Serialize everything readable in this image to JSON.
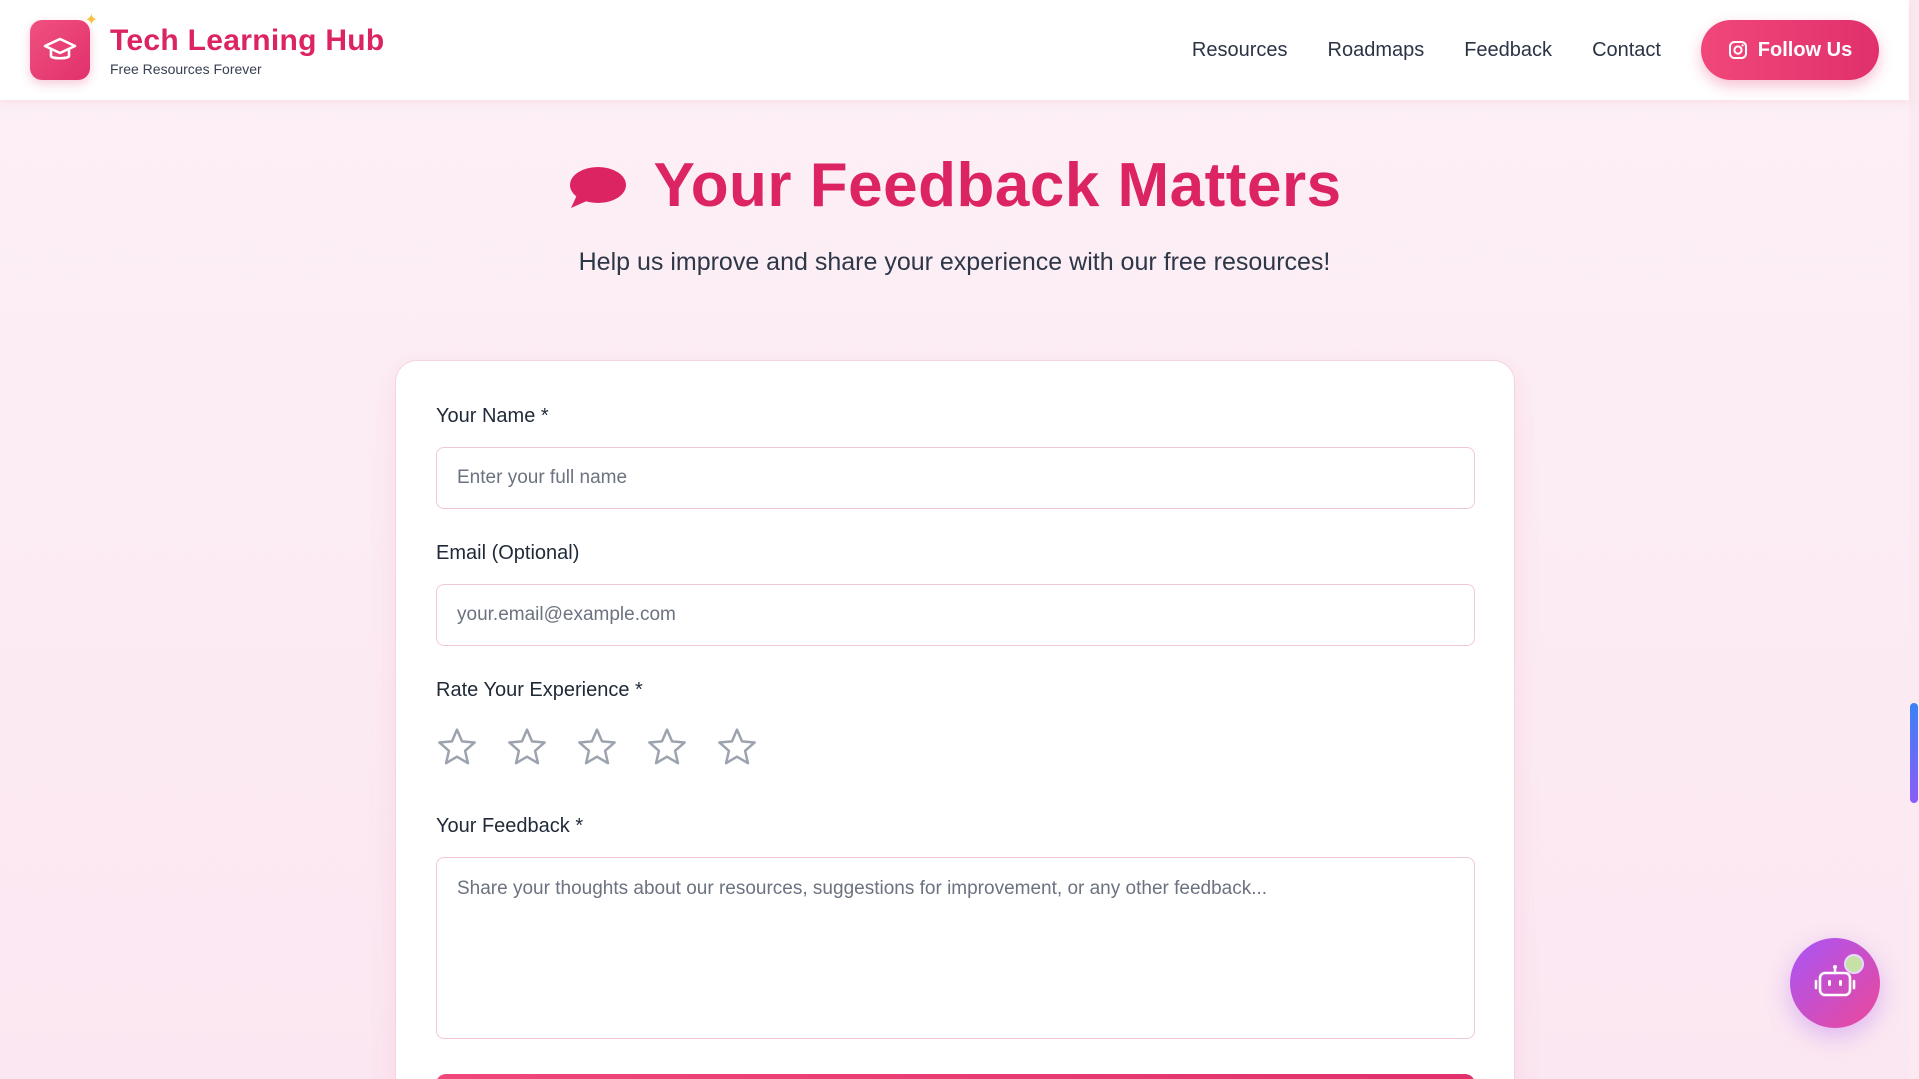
{
  "header": {
    "brand_title": "Tech Learning Hub",
    "brand_subtitle": "Free Resources Forever",
    "nav": [
      "Resources",
      "Roadmaps",
      "Feedback",
      "Contact"
    ],
    "follow_label": "Follow Us"
  },
  "hero": {
    "title": "Your Feedback Matters",
    "subtitle": "Help us improve and share your experience with our free resources!"
  },
  "form": {
    "name_label": "Your Name *",
    "name_placeholder": "Enter your full name",
    "email_label": "Email (Optional)",
    "email_placeholder": "your.email@example.com",
    "rating_label": "Rate Your Experience *",
    "rating_value": 0,
    "rating_max": 5,
    "feedback_label": "Your Feedback *",
    "feedback_placeholder": "Share your thoughts about our resources, suggestions for improvement, or any other feedback..."
  },
  "icons": {
    "logo": "graduation-cap-icon",
    "sparkle": "sparkle-icon",
    "instagram": "instagram-icon",
    "hero": "speech-bubble-icon",
    "star": "star-outline-icon",
    "chatbot": "robot-icon"
  },
  "colors": {
    "brand_pink": "#dc2463",
    "button_gradient_start": "#f0477a",
    "button_gradient_end": "#e1306c",
    "star_outline": "#9ca3af",
    "chatbot_gradient_start": "#a855f7",
    "chatbot_gradient_end": "#ec4899"
  }
}
